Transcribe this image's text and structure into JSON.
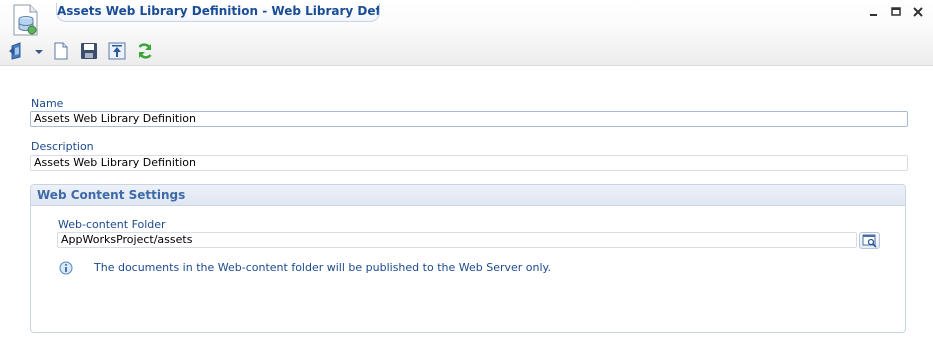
{
  "window": {
    "title": "Assets Web Library Definition - Web Library Definition"
  },
  "toolbar": {
    "icons": [
      "back-icon",
      "dropdown-arrow-icon",
      "new-document-icon",
      "save-icon",
      "publish-icon",
      "refresh-icon"
    ]
  },
  "form": {
    "name_label": "Name",
    "name_value": "Assets Web Library Definition",
    "description_label": "Description",
    "description_value": "Assets Web Library Definition"
  },
  "web_content_settings": {
    "header": "Web Content Settings",
    "folder_label": "Web-content Folder",
    "folder_value": "AppWorksProject/assets",
    "info_text": "The documents in the Web-content folder will be published to the Web Server only."
  },
  "colors": {
    "title_text": "#1b4d96",
    "label_text": "#1c4a8c",
    "panel_header_text": "#3d6aa8",
    "refresh_green": "#3aa53a"
  }
}
